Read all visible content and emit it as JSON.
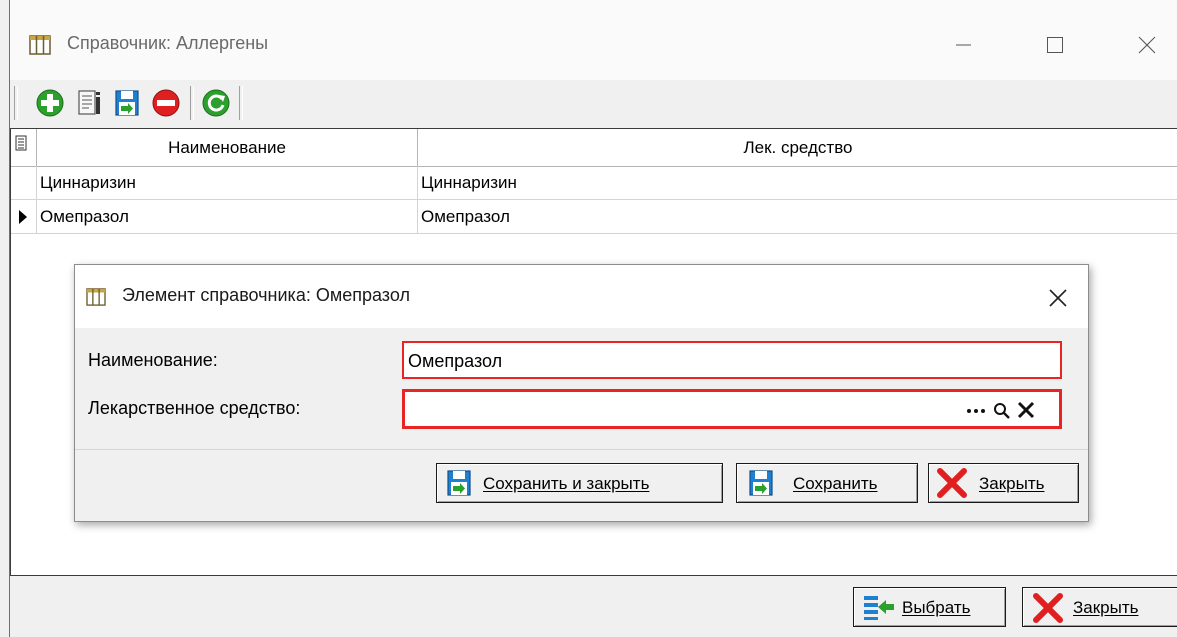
{
  "window": {
    "title": "Справочник: Аллергены"
  },
  "toolbar": {
    "buttons": [
      {
        "name": "add",
        "icon": "plus-circle-icon",
        "color": "#2ca02c"
      },
      {
        "name": "edit",
        "icon": "edit-document-icon"
      },
      {
        "name": "save",
        "icon": "save-disk-icon",
        "color": "#1f7fd0"
      },
      {
        "name": "delete",
        "icon": "minus-circle-icon",
        "color": "#e02020"
      },
      {
        "name": "refresh",
        "icon": "refresh-icon",
        "color": "#2ca02c"
      }
    ]
  },
  "grid": {
    "columns": [
      "Наименование",
      "Лек. средство"
    ],
    "rows": [
      {
        "name": "Циннаризин",
        "drug": "Циннаризин",
        "current": false
      },
      {
        "name": "Омепразол",
        "drug": "Омепразол",
        "current": true
      }
    ]
  },
  "footer": {
    "select_label": "Выбрать",
    "close_label": "Закрыть"
  },
  "dialog": {
    "title": "Элемент справочника: Омепразол",
    "fields": {
      "name_label": "Наименование:",
      "name_value": "Омепразол",
      "drug_label": "Лекарственное средство:",
      "drug_value": ""
    },
    "buttons": {
      "save_close_label": "Сохранить и закрыть",
      "save_label": "Сохранить",
      "close_label": "Закрыть"
    }
  },
  "colors": {
    "accent_red": "#e82424",
    "accent_green": "#2ca02c",
    "accent_blue": "#1f7fd0"
  }
}
